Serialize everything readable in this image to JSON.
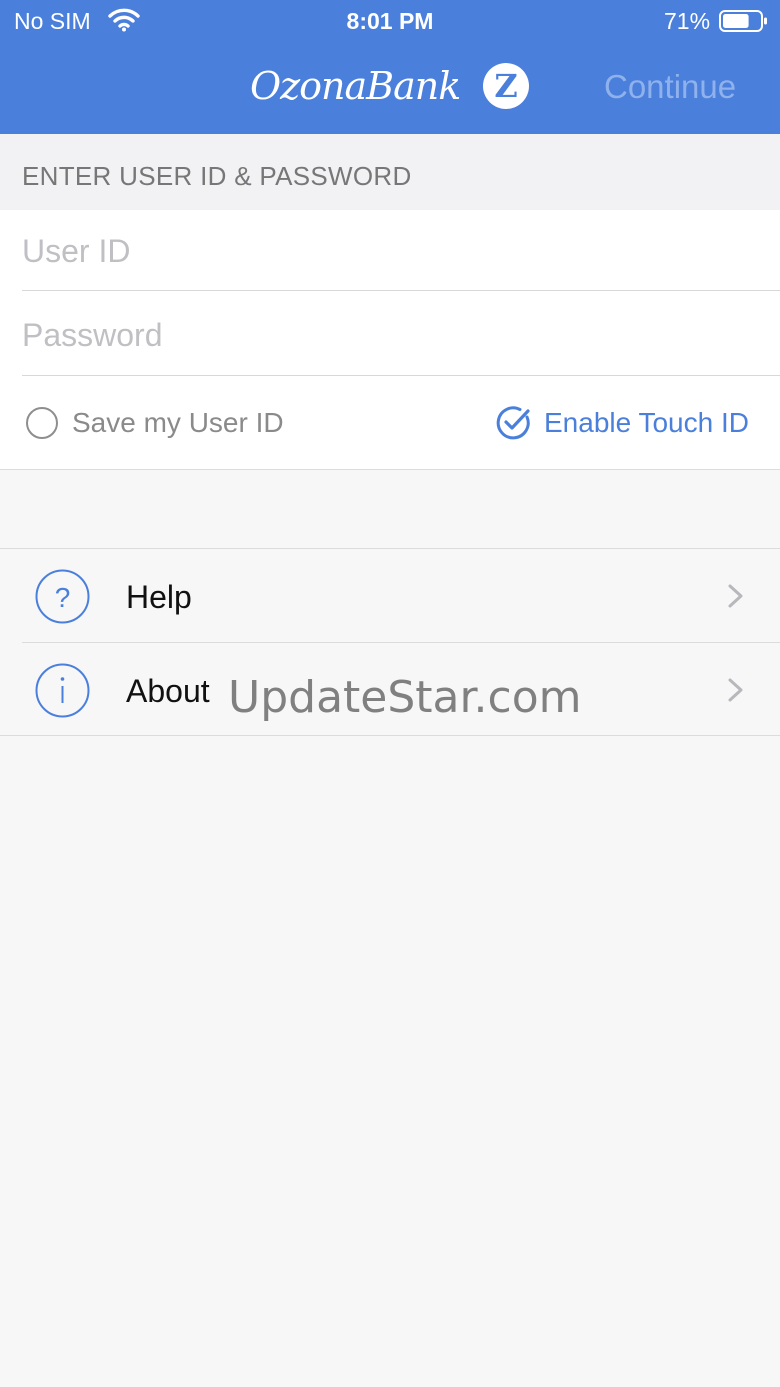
{
  "status_bar": {
    "carrier": "No SIM",
    "time": "8:01 PM",
    "battery": "71%",
    "battery_level": 0.71
  },
  "nav": {
    "logo_text": "OzonaBank",
    "logo_letter": "Z",
    "continue_label": "Continue"
  },
  "login": {
    "section_title": "ENTER USER ID & PASSWORD",
    "user_id_placeholder": "User ID",
    "password_placeholder": "Password",
    "save_user_id_label": "Save my User ID",
    "save_user_id_checked": false,
    "touch_id_label": "Enable Touch ID",
    "touch_id_checked": true
  },
  "menu": {
    "items": [
      {
        "label": "Help",
        "icon": "question-icon"
      },
      {
        "label": "About",
        "icon": "info-icon"
      }
    ]
  },
  "watermark": "UpdateStar.com",
  "colors": {
    "brand_blue": "#4a7fdc",
    "background": "#f7f7f7",
    "continue_disabled": "#8fb1ec"
  }
}
